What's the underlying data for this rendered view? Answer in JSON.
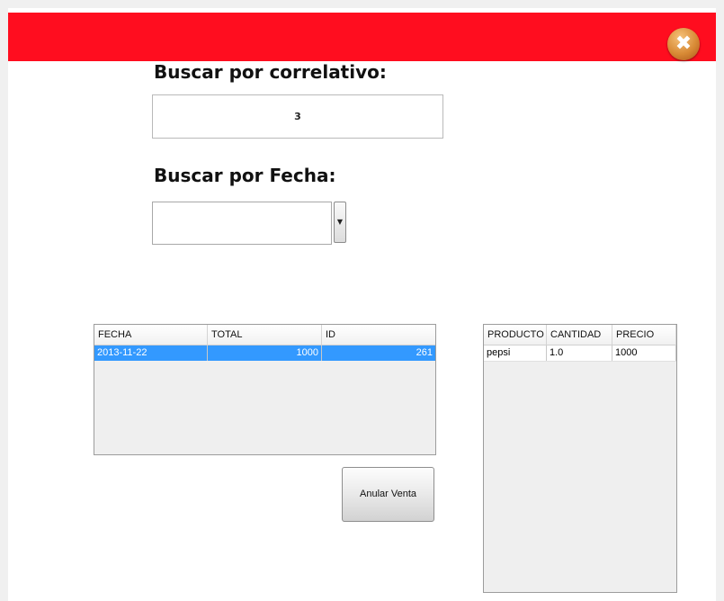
{
  "window": {
    "close_glyph": "✖",
    "title_bar_color": "#ff0d1f"
  },
  "search_by_correlative": {
    "label": "Buscar por correlativo:",
    "value": "3"
  },
  "search_by_date": {
    "label": "Buscar por Fecha:",
    "value": "",
    "arrow_glyph": "▼"
  },
  "sales_table": {
    "columns": [
      "FECHA",
      "TOTAL",
      "ID"
    ],
    "rows": [
      {
        "fecha": "2013-11-22",
        "total": "1000",
        "id": "261",
        "selected": true
      }
    ]
  },
  "detail_table": {
    "columns": [
      "PRODUCTO",
      "CANTIDAD",
      "PRECIO"
    ],
    "rows": [
      {
        "producto": "pepsi",
        "cantidad": "1.0",
        "precio": "1000"
      }
    ]
  },
  "void_button": {
    "label": "Anular Venta"
  },
  "colors": {
    "selection": "#3399ff",
    "accent": "#ff0d1f"
  }
}
